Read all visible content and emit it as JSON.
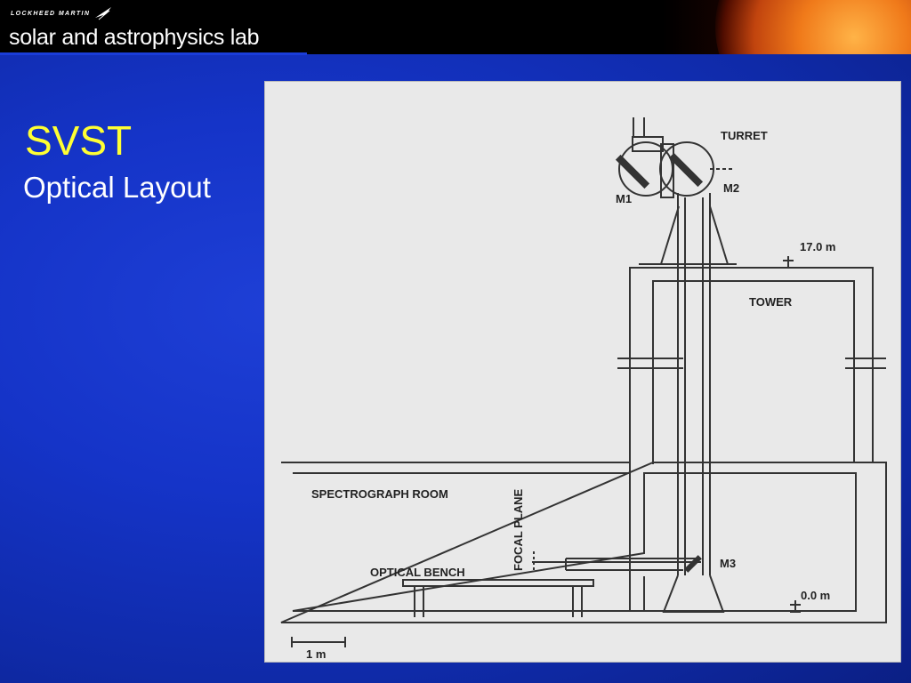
{
  "header": {
    "logo_text": "LOCKHEED MARTIN",
    "lab_title": "solar and astrophysics lab"
  },
  "slide": {
    "title": "SVST",
    "subtitle": "Optical Layout"
  },
  "diagram": {
    "labels": {
      "turret": "TURRET",
      "m1": "M1",
      "m2": "M2",
      "m3": "M3",
      "height_top": "17.0 m",
      "height_bottom": "0.0 m",
      "tower": "TOWER",
      "spectrograph_room": "SPECTROGRAPH ROOM",
      "focal_plane": "FOCAL PLANE",
      "optical_bench": "OPTICAL BENCH",
      "scale": "1 m"
    }
  },
  "colors": {
    "background": "#1534c8",
    "title": "#ffff33",
    "subtitle": "#ffffff",
    "figure_bg": "#e9e9e9",
    "line": "#333333"
  }
}
